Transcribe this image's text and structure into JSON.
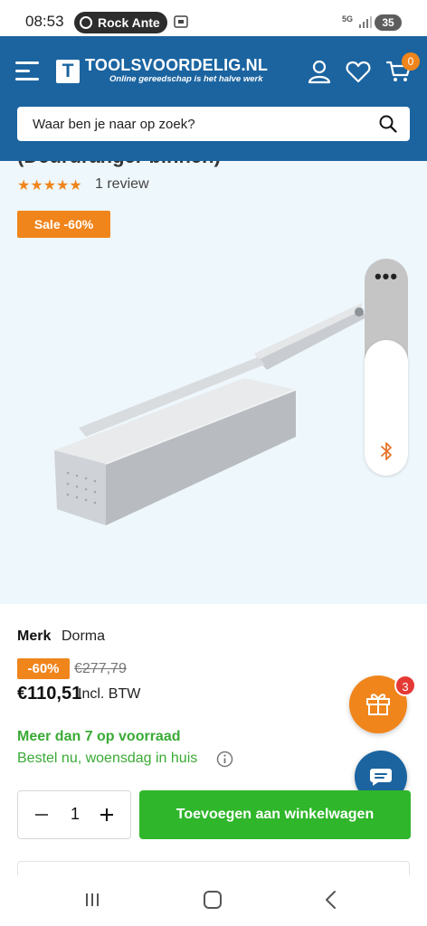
{
  "status_bar": {
    "time": "08:53",
    "notification": "Rock Ante",
    "network": "5G",
    "battery": "35"
  },
  "header": {
    "logo_letter": "T",
    "brand_name": "TOOLSVOORDELIG.NL",
    "tagline": "Online gereedschap is het halve werk",
    "cart_count": "0",
    "background_color": "#1b64a0",
    "icons": [
      "menu-icon",
      "user-icon",
      "heart-icon",
      "cart-icon"
    ]
  },
  "search": {
    "placeholder": "Waar ben je naar op zoek?"
  },
  "product": {
    "title_cut": "(Deurdranger binnen)",
    "rating_stars": "★★★★★",
    "rating": 5,
    "review_text": "1 review",
    "sale_badge": "Sale -60%",
    "brand_label": "Merk",
    "brand_value": "Dorma",
    "discount": "-60%",
    "old_price": "€277,79",
    "price": "€110,51",
    "price_note": "Incl. BTW",
    "stock": "Meer dan 7 op voorraad",
    "delivery": "Bestel nu, woensdag in huis",
    "quantity": "1",
    "add_to_cart": "Toevoegen aan winkelwagen"
  },
  "side_panel": {
    "dots": "•••"
  },
  "floating": {
    "gift_badge": "3"
  },
  "colors": {
    "accent_orange": "#f0851c",
    "stock_green": "#3aaa35",
    "button_green": "#2fb62b",
    "product_bg": "#eef7fc"
  }
}
